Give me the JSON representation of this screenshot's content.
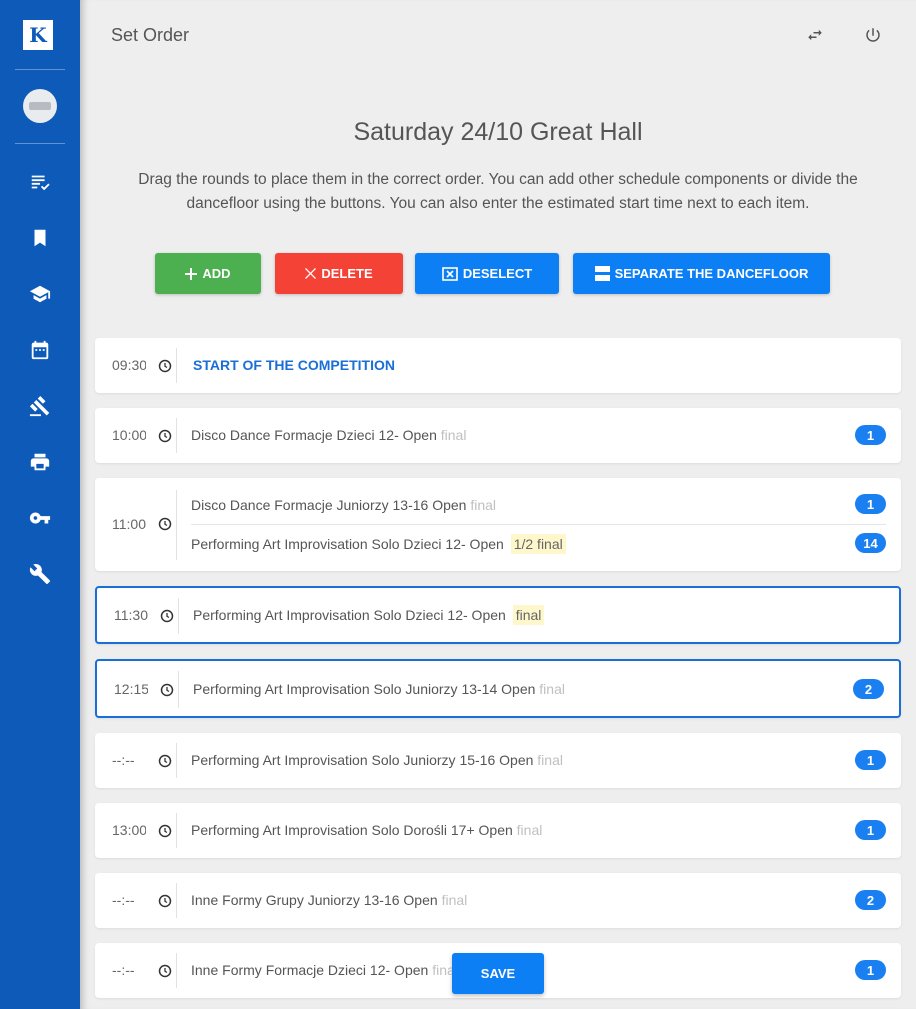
{
  "app": {
    "logo_letter": "K"
  },
  "header": {
    "title": "Set Order"
  },
  "page": {
    "heading": "Saturday 24/10 Great Hall",
    "description": "Drag the rounds to place them in the correct order. You can add other schedule components or divide the dancefloor using the buttons. You can also enter the estimated start time next to each item."
  },
  "buttons": {
    "add": "ADD",
    "delete": "DELETE",
    "deselect": "DESELECT",
    "separate": "SEPARATE THE DANCEFLOOR",
    "save": "SAVE"
  },
  "rows": [
    {
      "time": "09:30",
      "title": "START OF THE COMPETITION"
    },
    {
      "time": "10:00",
      "items": [
        {
          "name": "Disco Dance Formacje Dzieci 12- Open",
          "round": "final",
          "count": "1"
        }
      ]
    },
    {
      "time": "11:00",
      "items": [
        {
          "name": "Disco Dance Formacje Juniorzy 13-16 Open",
          "round": "final",
          "count": "1"
        },
        {
          "name": "Performing Art Improvisation Solo Dzieci 12- Open",
          "round": "1/2 final",
          "count": "14"
        }
      ]
    },
    {
      "time": "11:30",
      "items": [
        {
          "name": "Performing Art Improvisation Solo Dzieci 12- Open",
          "round": "final"
        }
      ]
    },
    {
      "time": "12:15",
      "items": [
        {
          "name": "Performing Art Improvisation Solo Juniorzy 13-14 Open",
          "round": "final",
          "count": "2"
        }
      ]
    },
    {
      "time": "--:--",
      "items": [
        {
          "name": "Performing Art Improvisation Solo Juniorzy 15-16 Open",
          "round": "final",
          "count": "1"
        }
      ]
    },
    {
      "time": "13:00",
      "items": [
        {
          "name": "Performing Art Improvisation Solo Dorośli 17+ Open",
          "round": "final",
          "count": "1"
        }
      ]
    },
    {
      "time": "--:--",
      "items": [
        {
          "name": "Inne Formy Grupy Juniorzy 13-16 Open",
          "round": "final",
          "count": "2"
        }
      ]
    },
    {
      "time": "--:--",
      "items": [
        {
          "name": "Inne Formy Formacje Dzieci 12- Open",
          "round": "final",
          "count": "1"
        }
      ]
    }
  ],
  "colors": {
    "sidebar": "#0d5ab8",
    "primary": "#0d7ff5",
    "add": "#4caf50",
    "delete": "#f44336",
    "highlight": "#fff7cc"
  },
  "icons": [
    "checklist-icon",
    "bookmark-icon",
    "graduation-cap-icon",
    "calendar-icon",
    "gavel-icon",
    "printer-icon",
    "key-icon",
    "wrench-icon",
    "swap-icon",
    "power-icon",
    "clock-icon"
  ]
}
